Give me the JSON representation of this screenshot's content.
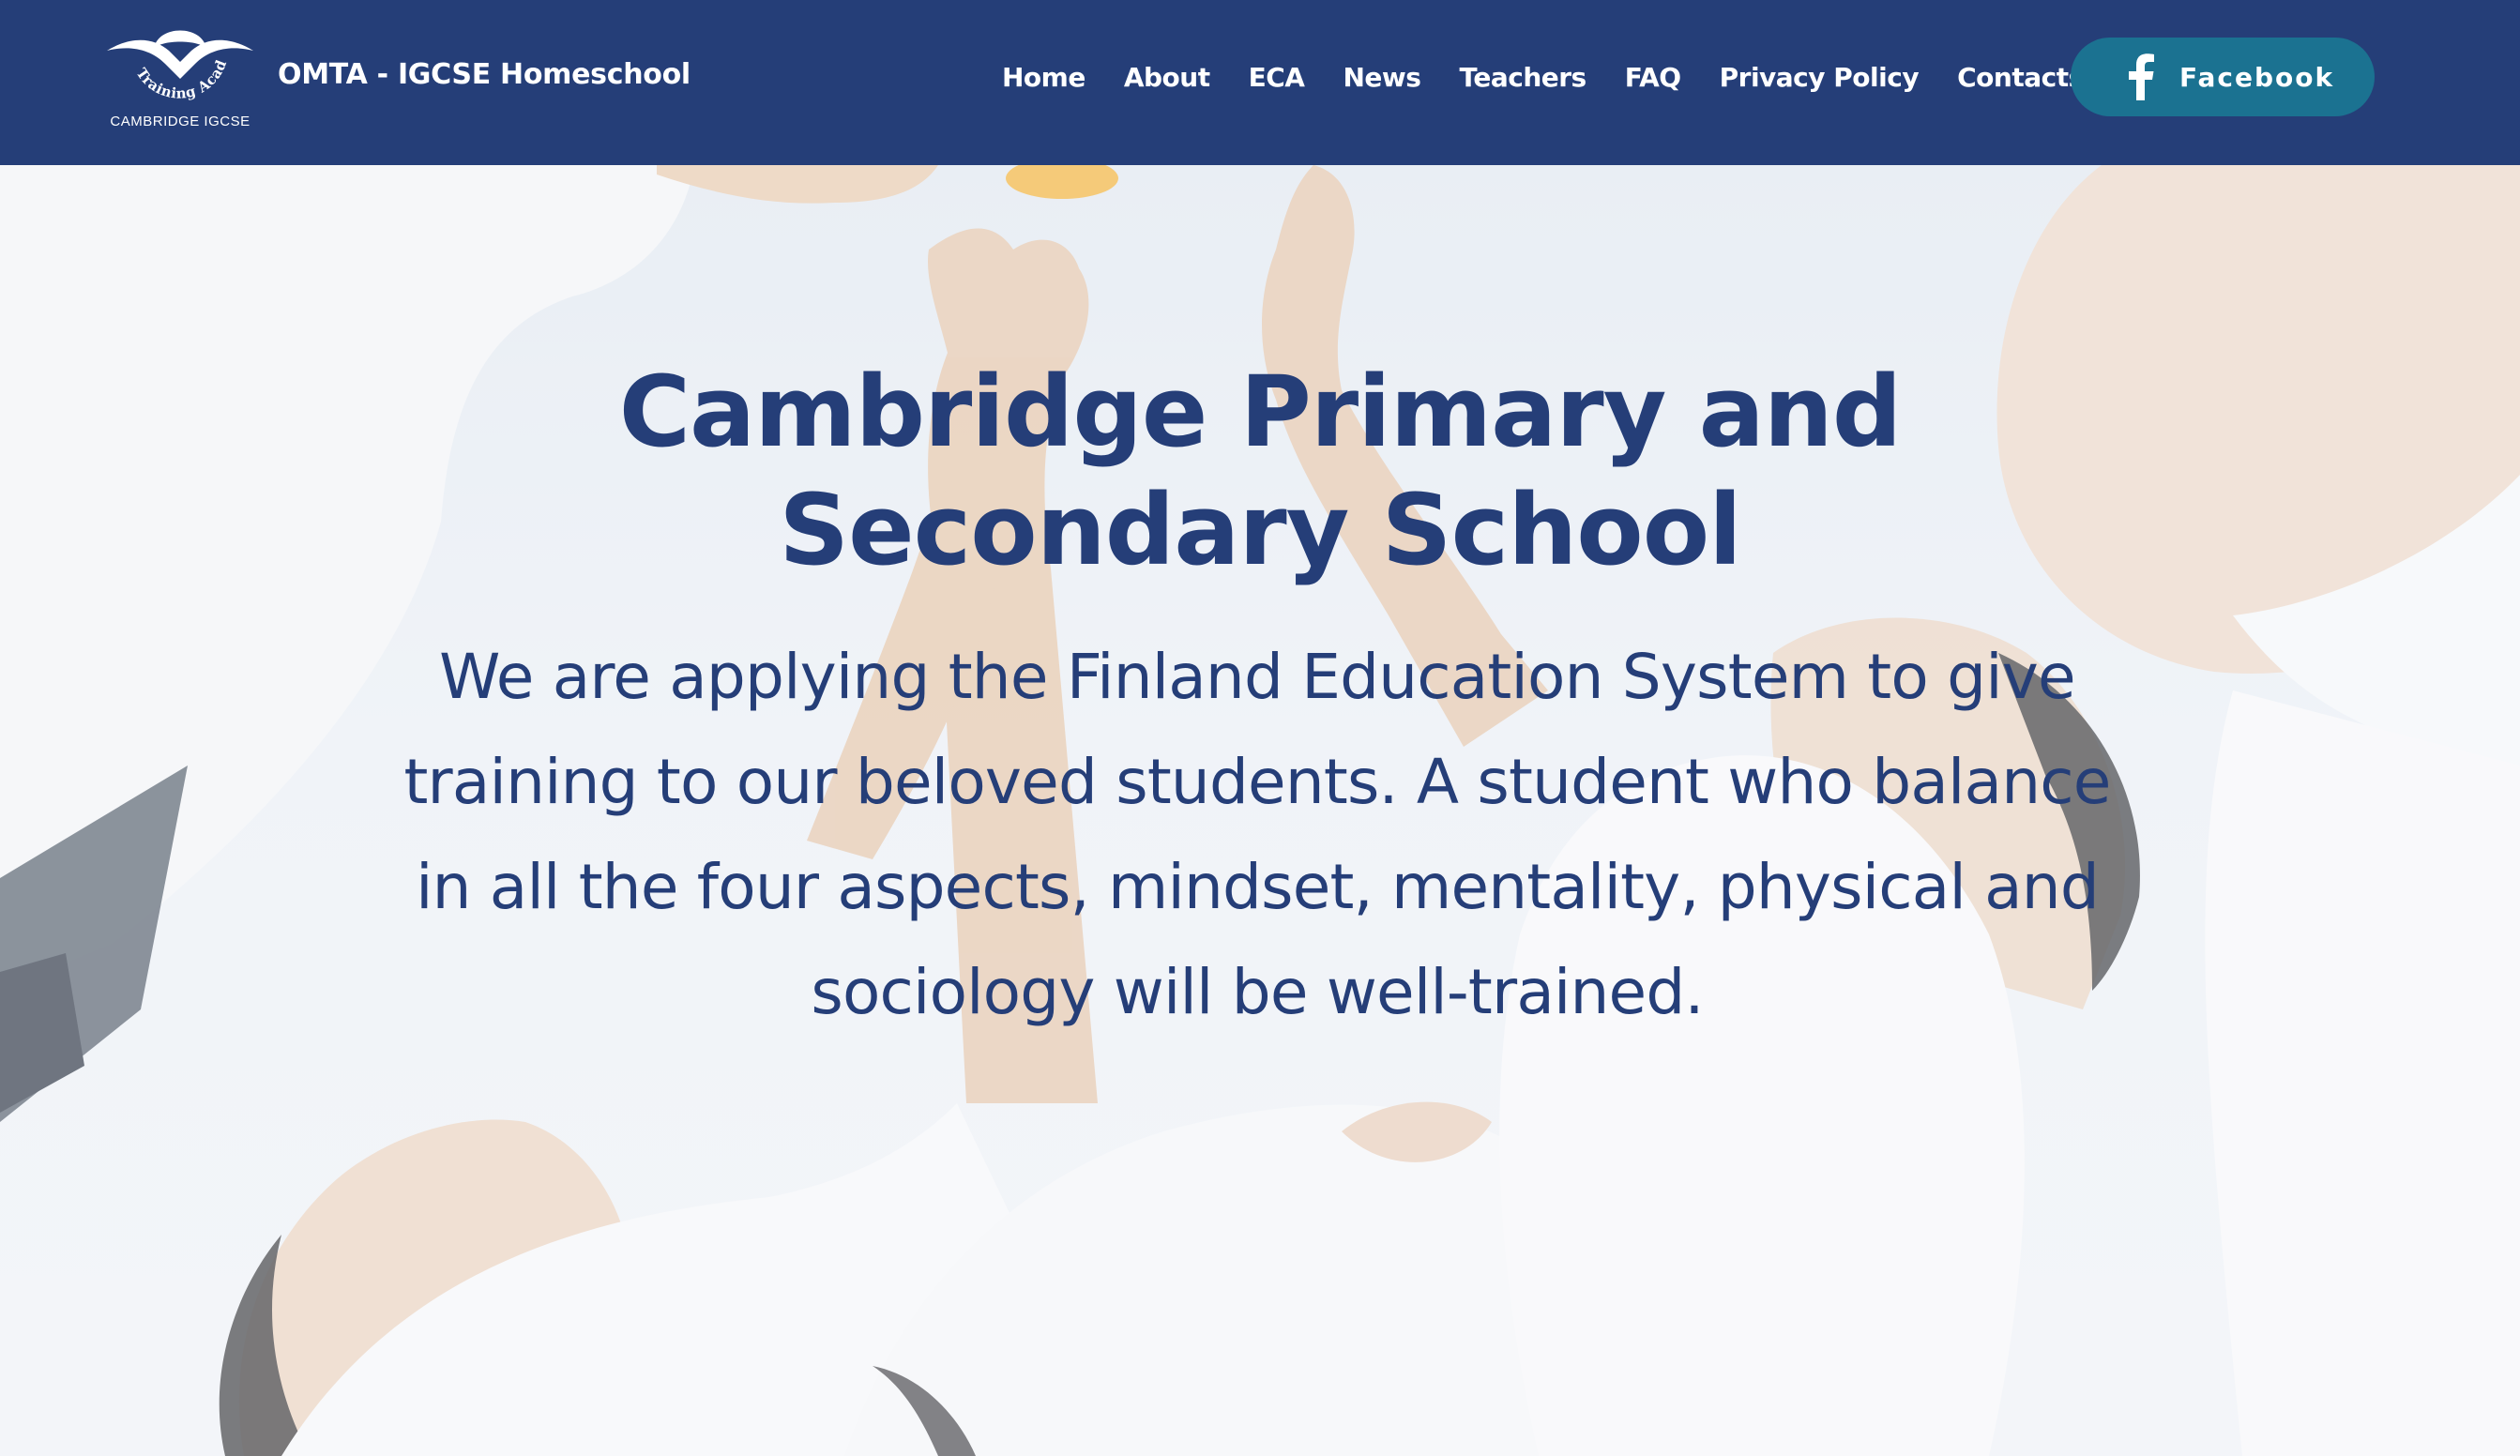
{
  "header": {
    "logo": {
      "arc_text": "Training Academy",
      "caption": "CAMBRIDGE IGCSE"
    },
    "site_title": "OMTA - IGCSE Homeschool",
    "nav": [
      {
        "label": "Home"
      },
      {
        "label": "About"
      },
      {
        "label": "ECA"
      },
      {
        "label": "News"
      },
      {
        "label": "Teachers"
      },
      {
        "label": "FAQ"
      },
      {
        "label": "Privacy Policy"
      },
      {
        "label": "Contacts"
      }
    ],
    "facebook_button": {
      "label": "Facebook",
      "icon": "facebook-f-icon"
    }
  },
  "hero": {
    "title": "Cambridge Primary and Secondary School",
    "description": "We are applying the Finland Education System to give training to our beloved students. A student who balance in all the four aspects, mindset, mentality, physical and sociology will be well-trained."
  },
  "colors": {
    "header_bg": "#253e78",
    "facebook_button_bg": "#1b7291",
    "hero_text": "#253e78",
    "nav_text": "#ffffff"
  }
}
